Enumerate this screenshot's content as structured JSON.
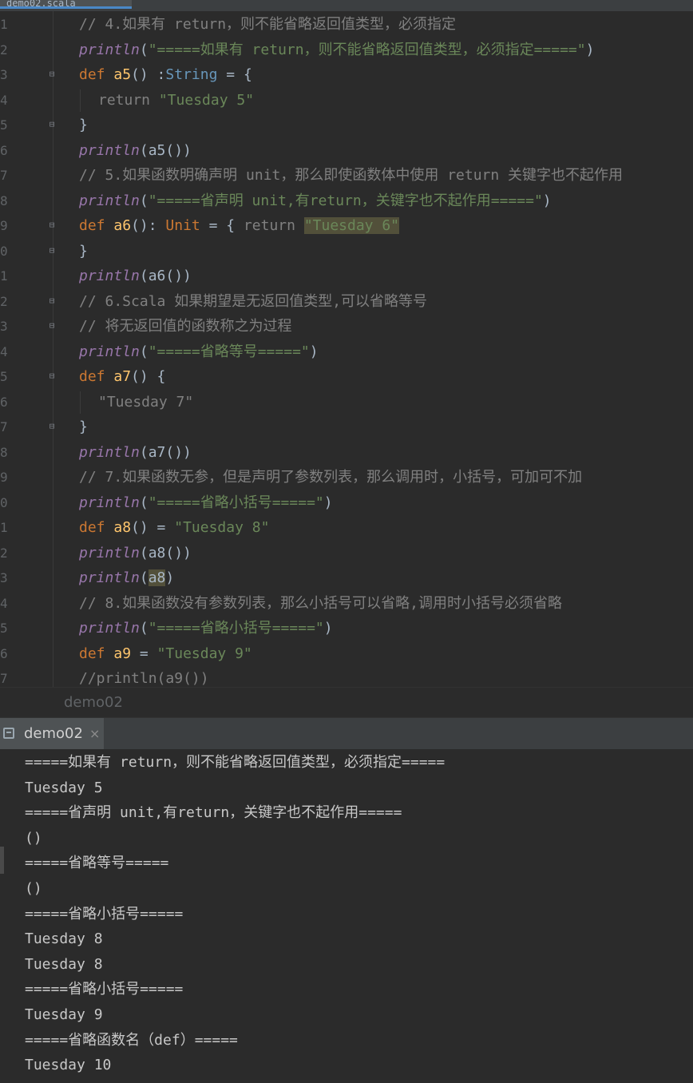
{
  "top_tab": {
    "label": "demo02.scala"
  },
  "editor": {
    "lines": [
      {
        "ln": "1",
        "tokens": [
          {
            "t": "// 4.如果有 return，则不能省略返回值类型，必须指定",
            "c": "cm"
          }
        ]
      },
      {
        "ln": "2",
        "tokens": [
          {
            "t": "println",
            "c": "it"
          },
          {
            "t": "(",
            "c": ""
          },
          {
            "t": "\"=====如果有 return，则不能省略返回值类型，必须指定=====\"",
            "c": "str"
          },
          {
            "t": ")",
            "c": ""
          }
        ]
      },
      {
        "ln": "3",
        "fold": "open",
        "tokens": [
          {
            "t": "def ",
            "c": "kw"
          },
          {
            "t": "a5",
            "c": "fn"
          },
          {
            "t": "() :",
            "c": ""
          },
          {
            "t": "String",
            "c": "ty"
          },
          {
            "t": " = {",
            "c": ""
          }
        ]
      },
      {
        "ln": "4",
        "indent": true,
        "tokens": [
          {
            "t": "return ",
            "c": "dim"
          },
          {
            "t": "\"Tuesday 5\"",
            "c": "str"
          }
        ]
      },
      {
        "ln": "5",
        "fold": "close",
        "tokens": [
          {
            "t": "}",
            "c": ""
          }
        ]
      },
      {
        "ln": "6",
        "tokens": [
          {
            "t": "println",
            "c": "it"
          },
          {
            "t": "(a5())",
            "c": ""
          }
        ]
      },
      {
        "ln": "7",
        "tokens": [
          {
            "t": "// 5.如果函数明确声明 unit，那么即使函数体中使用 return 关键字也不起作用",
            "c": "cm"
          }
        ]
      },
      {
        "ln": "8",
        "tokens": [
          {
            "t": "println",
            "c": "it"
          },
          {
            "t": "(",
            "c": ""
          },
          {
            "t": "\"=====省声明 unit,有return，关键字也不起作用=====\"",
            "c": "str"
          },
          {
            "t": ")",
            "c": ""
          }
        ]
      },
      {
        "ln": "9",
        "fold": "open",
        "tokens": [
          {
            "t": "def ",
            "c": "kw"
          },
          {
            "t": "a6",
            "c": "fn"
          },
          {
            "t": "(): ",
            "c": ""
          },
          {
            "t": "Unit",
            "c": "kw"
          },
          {
            "t": " = { ",
            "c": ""
          },
          {
            "t": "return ",
            "c": "dim"
          },
          {
            "t": "\"Tuesday 6\"",
            "c": "str hl"
          }
        ]
      },
      {
        "ln": "0",
        "fold": "close",
        "tokens": [
          {
            "t": "}",
            "c": ""
          }
        ]
      },
      {
        "ln": "1",
        "tokens": [
          {
            "t": "println",
            "c": "it"
          },
          {
            "t": "(a6())",
            "c": ""
          }
        ]
      },
      {
        "ln": "2",
        "fold": "open",
        "tokens": [
          {
            "t": "// 6.Scala 如果期望是无返回值类型,可以省略等号",
            "c": "cm"
          }
        ]
      },
      {
        "ln": "3",
        "fold": "close",
        "tokens": [
          {
            "t": "// 将无返回值的函数称之为过程",
            "c": "cm"
          }
        ]
      },
      {
        "ln": "4",
        "tokens": [
          {
            "t": "println",
            "c": "it"
          },
          {
            "t": "(",
            "c": ""
          },
          {
            "t": "\"=====省略等号=====\"",
            "c": "str"
          },
          {
            "t": ")",
            "c": ""
          }
        ]
      },
      {
        "ln": "5",
        "fold": "open",
        "tokens": [
          {
            "t": "def ",
            "c": "kw"
          },
          {
            "t": "a7",
            "c": "fn"
          },
          {
            "t": "() {",
            "c": ""
          }
        ]
      },
      {
        "ln": "6",
        "indent": true,
        "tokens": [
          {
            "t": "\"Tuesday 7\"",
            "c": "dim"
          }
        ]
      },
      {
        "ln": "7",
        "fold": "close",
        "tokens": [
          {
            "t": "}",
            "c": ""
          }
        ]
      },
      {
        "ln": "8",
        "tokens": [
          {
            "t": "println",
            "c": "it"
          },
          {
            "t": "(a7())",
            "c": ""
          }
        ]
      },
      {
        "ln": "9",
        "tokens": [
          {
            "t": "// 7.如果函数无参，但是声明了参数列表，那么调用时，小括号，可加可不加",
            "c": "cm"
          }
        ]
      },
      {
        "ln": "0",
        "tokens": [
          {
            "t": "println",
            "c": "it"
          },
          {
            "t": "(",
            "c": ""
          },
          {
            "t": "\"=====省略小括号=====\"",
            "c": "str"
          },
          {
            "t": ")",
            "c": ""
          }
        ]
      },
      {
        "ln": "1",
        "tokens": [
          {
            "t": "def ",
            "c": "kw"
          },
          {
            "t": "a8",
            "c": "fn"
          },
          {
            "t": "() = ",
            "c": ""
          },
          {
            "t": "\"Tuesday 8\"",
            "c": "str"
          }
        ]
      },
      {
        "ln": "2",
        "tokens": [
          {
            "t": "println",
            "c": "it"
          },
          {
            "t": "(a8())",
            "c": ""
          }
        ]
      },
      {
        "ln": "3",
        "tokens": [
          {
            "t": "println",
            "c": "it"
          },
          {
            "t": "(",
            "c": ""
          },
          {
            "t": "a8",
            "c": "hl"
          },
          {
            "t": ")",
            "c": ""
          }
        ]
      },
      {
        "ln": "4",
        "tokens": [
          {
            "t": "// 8.如果函数没有参数列表，那么小括号可以省略,调用时小括号必须省略",
            "c": "cm"
          }
        ]
      },
      {
        "ln": "5",
        "tokens": [
          {
            "t": "println",
            "c": "it"
          },
          {
            "t": "(",
            "c": ""
          },
          {
            "t": "\"=====省略小括号=====\"",
            "c": "str"
          },
          {
            "t": ")",
            "c": ""
          }
        ]
      },
      {
        "ln": "6",
        "tokens": [
          {
            "t": "def ",
            "c": "kw"
          },
          {
            "t": "a9",
            "c": "fn"
          },
          {
            "t": " = ",
            "c": ""
          },
          {
            "t": "\"Tuesday 9\"",
            "c": "str"
          }
        ]
      },
      {
        "ln": "7",
        "tokens": [
          {
            "t": "//println(a9())",
            "c": "cm"
          }
        ]
      }
    ]
  },
  "breadcrumb": "demo02",
  "run_panel": {
    "tab_label": "demo02",
    "close_glyph": "×",
    "output": [
      "=====如果有 return，则不能省略返回值类型，必须指定=====",
      "Tuesday 5",
      "=====省声明 unit,有return，关键字也不起作用=====",
      "()",
      "=====省略等号=====",
      "()",
      "=====省略小括号=====",
      "Tuesday 8",
      "Tuesday 8",
      "=====省略小括号=====",
      "Tuesday 9",
      "=====省略函数名（def）=====",
      "Tuesday 10"
    ]
  },
  "colors": {
    "keyword": "#cc7832",
    "function": "#ffc66d",
    "string": "#6a8759",
    "italic_call": "#9876aa",
    "comment": "#808080",
    "type": "#6897bb",
    "background": "#2b2b2b"
  }
}
